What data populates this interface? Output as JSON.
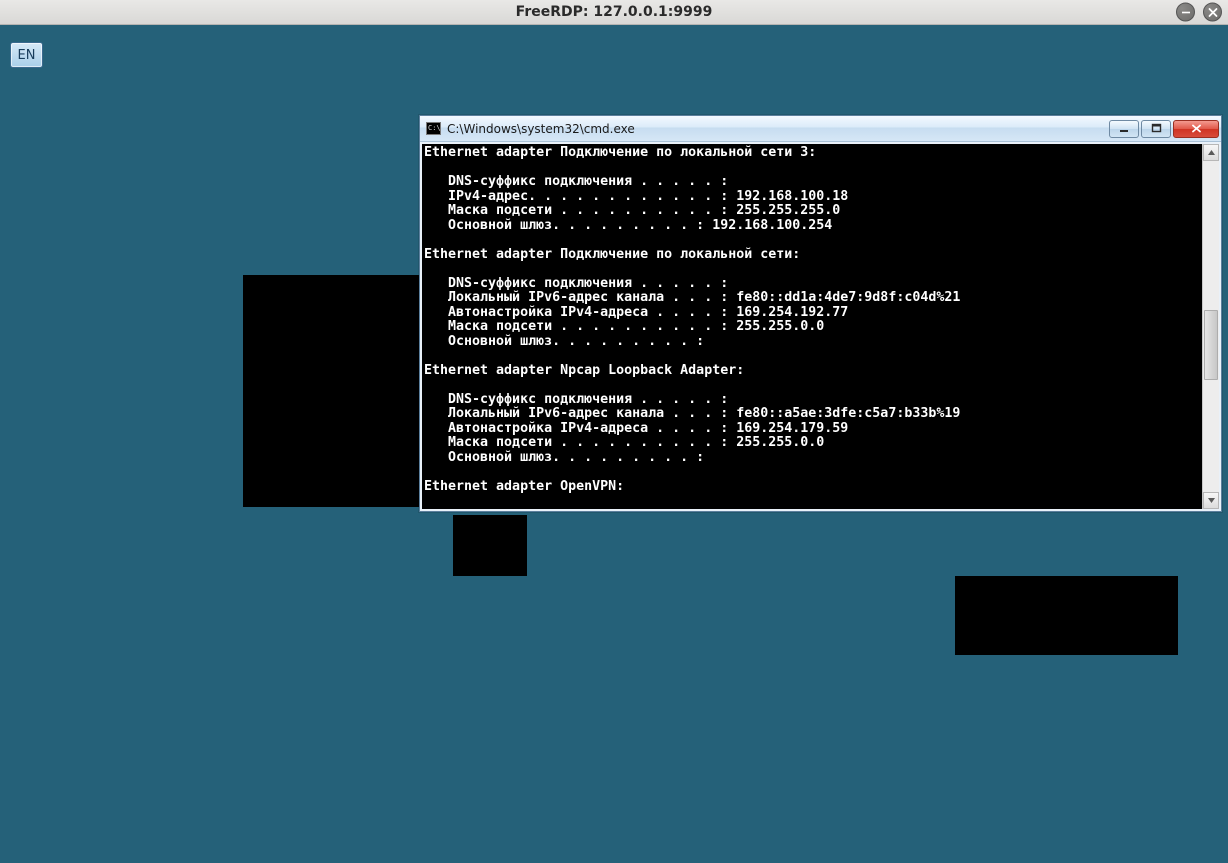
{
  "host": {
    "title": "FreeRDP: 127.0.0.1:9999"
  },
  "lang": "EN",
  "cmd": {
    "title": "C:\\Windows\\system32\\cmd.exe",
    "icon_text": "C:\\",
    "output": "Ethernet adapter Подключение по локальной сети 3:\n\n   DNS-суффикс подключения . . . . . :\n   IPv4-адрес. . . . . . . . . . . . : 192.168.100.18\n   Маска подсети . . . . . . . . . . : 255.255.255.0\n   Основной шлюз. . . . . . . . . : 192.168.100.254\n\nEthernet adapter Подключение по локальной сети:\n\n   DNS-суффикс подключения . . . . . :\n   Локальный IPv6-адрес канала . . . : fe80::dd1a:4de7:9d8f:c04d%21\n   Автонастройка IPv4-адреса . . . . : 169.254.192.77\n   Маска подсети . . . . . . . . . . : 255.255.0.0\n   Основной шлюз. . . . . . . . . :\n\nEthernet adapter Npcap Loopback Adapter:\n\n   DNS-суффикс подключения . . . . . :\n   Локальный IPv6-адрес канала . . . : fe80::a5ae:3dfe:c5a7:b33b%19\n   Автонастройка IPv4-адреса . . . . : 169.254.179.59\n   Маска подсети . . . . . . . . . . : 255.255.0.0\n   Основной шлюз. . . . . . . . . :\n\nEthernet adapter OpenVPN:"
  }
}
